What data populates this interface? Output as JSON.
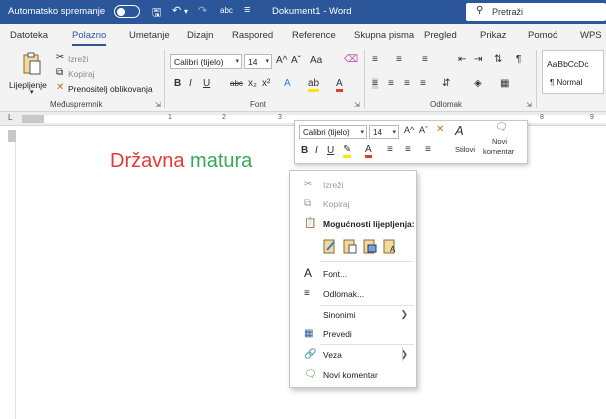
{
  "titlebar": {
    "autosave_label": "Automatsko spremanje",
    "toggle_state": "Isk",
    "document_title": "Dokument1  -  Word",
    "search_placeholder": "Pretraži"
  },
  "tabs": [
    {
      "label": "Datoteka"
    },
    {
      "label": "Polazno"
    },
    {
      "label": "Umetanje"
    },
    {
      "label": "Dizajn"
    },
    {
      "label": "Raspored"
    },
    {
      "label": "Reference"
    },
    {
      "label": "Skupna pisma"
    },
    {
      "label": "Pregled"
    },
    {
      "label": "Prikaz"
    },
    {
      "label": "Pomoć"
    },
    {
      "label": "WPS"
    }
  ],
  "clipboard": {
    "paste_label": "Lijepljenje",
    "cut_label": "Izreži",
    "copy_label": "Kopiraj",
    "format_painter_label": "Prenositelj oblikovanja",
    "group_label": "Međuspremnik"
  },
  "font": {
    "font_name": "Calibri (tijelo)",
    "font_size": "14",
    "group_label": "Font",
    "bold": "B",
    "italic": "I",
    "underline": "U",
    "strike": "abc",
    "subscript": "x₂",
    "superscript": "x²",
    "grow": "A^",
    "shrink": "Aˇ",
    "case": "Aa",
    "text_effects": "A",
    "highlight": "ab",
    "font_color": "A"
  },
  "paragraph": {
    "group_label": "Odlomak"
  },
  "styles": {
    "preview_text": "AaBbCcDc",
    "normal_label": "¶ Normal"
  },
  "ruler": {
    "numbers": [
      "1",
      "2",
      "3",
      "8",
      "9"
    ]
  },
  "document": {
    "word1": "Državna",
    "word2": "matura"
  },
  "mini_toolbar": {
    "font_name": "Calibri (tijelo)",
    "font_size": "14",
    "styles_label": "Stilovi",
    "new_comment_line1": "Novi",
    "new_comment_line2": "komentar"
  },
  "context_menu": {
    "cut": "Izreži",
    "copy": "Kopiraj",
    "paste_options": "Mogućnosti lijepljenja:",
    "font": "Font...",
    "paragraph": "Odlomak...",
    "synonyms": "Sinonimi",
    "translate": "Prevedi",
    "link": "Veza",
    "new_comment": "Novi komentar"
  },
  "colors": {
    "titlebar": "#2b579a",
    "accent": "#2b579a",
    "word1_color": "#e53935",
    "word2_color": "#35a853",
    "highlight": "#ffe600",
    "font_color_bar": "#e53935"
  }
}
